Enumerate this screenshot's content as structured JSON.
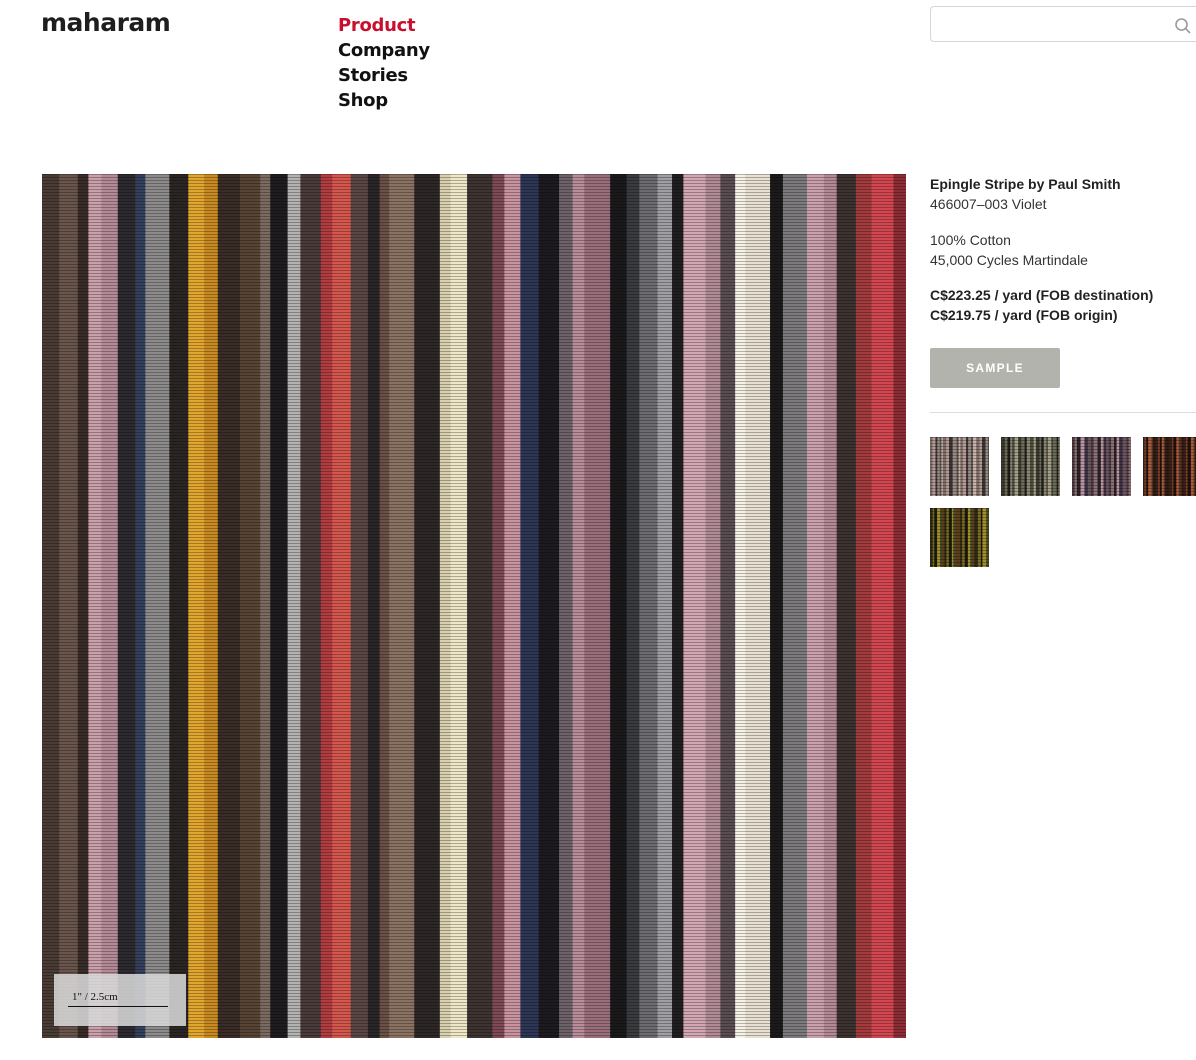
{
  "brand": {
    "name": "maharam"
  },
  "nav": {
    "items": [
      {
        "label": "Product",
        "active": true
      },
      {
        "label": "Company",
        "active": false
      },
      {
        "label": "Stories",
        "active": false
      },
      {
        "label": "Shop",
        "active": false
      }
    ]
  },
  "search": {
    "value": "",
    "placeholder": "",
    "icon": "search-icon"
  },
  "swatch": {
    "scale_label": "1\" / 2.5cm",
    "stripe_colors": [
      "#4a3b34",
      "#6a554c",
      "#3a2d28",
      "#c9a0ac",
      "#b48a96",
      "#2d2a30",
      "#34405c",
      "#8c8a8a",
      "#2b2524",
      "#e2a62f",
      "#c98a22",
      "#3a2c26",
      "#574434",
      "#7a6a60",
      "#1f1d1f",
      "#b2b2b2",
      "#4a3a3a",
      "#b23d41",
      "#d4574d",
      "#5a4644",
      "#2a2528",
      "#6a5046",
      "#8a7262",
      "#2e2728",
      "#d7cfae",
      "#efe7c8",
      "#3d3331",
      "#7d4a56",
      "#c8929e",
      "#2e3656",
      "#1d1b20",
      "#6d6268",
      "#b88c99",
      "#9a6d7a",
      "#1a1a1c",
      "#3a3b3f",
      "#6c6c70",
      "#9e9ea3",
      "#201e20",
      "#d3a6b3",
      "#b08a95",
      "#5a4d52",
      "#f6f2e8",
      "#e7dfd0",
      "#1c1a1b",
      "#7c7a7c",
      "#caa0ac",
      "#b28995",
      "#3c3230",
      "#a23b3e",
      "#d24650",
      "#8d2d36",
      "#8e8e94",
      "#3a3032",
      "#b7949f",
      "#6b5a5e",
      "#2a2224",
      "#a9a9b0"
    ]
  },
  "product": {
    "name": "Epingle Stripe by Paul Smith",
    "code": "466007–003 Violet",
    "specs": [
      "100% Cotton",
      "45,000 Cycles Martindale"
    ],
    "prices": [
      "C$223.25 / yard (FOB destination)",
      "C$219.75 / yard (FOB origin)"
    ]
  },
  "sample_button": {
    "label": "SAMPLE",
    "color": "#b3b3ae"
  },
  "colorways": [
    {
      "name": "colorway-1",
      "colors": [
        "#7a6e66",
        "#b79a96",
        "#3a3634",
        "#9a8a84",
        "#5c544f",
        "#c7b2ac"
      ]
    },
    {
      "name": "colorway-2",
      "colors": [
        "#3a3a30",
        "#6c6a58",
        "#1e1e1c",
        "#8a8672",
        "#4e4c40",
        "#a39e88"
      ]
    },
    {
      "name": "colorway-3",
      "colors": [
        "#4a3a3c",
        "#8c6f78",
        "#2a2224",
        "#b593a0",
        "#3e3040",
        "#6a5660"
      ]
    },
    {
      "name": "colorway-4",
      "colors": [
        "#3a2118",
        "#7a3e28",
        "#1e120e",
        "#a85b3c",
        "#5a3322",
        "#2c1a14"
      ]
    },
    {
      "name": "colorway-5",
      "colors": [
        "#2e2a14",
        "#7a6a22",
        "#1a1a10",
        "#a38e2c",
        "#4a4a24",
        "#5e3e1a"
      ]
    }
  ],
  "colors": {
    "accent": "#c8102e",
    "text": "#1a1a1a"
  }
}
